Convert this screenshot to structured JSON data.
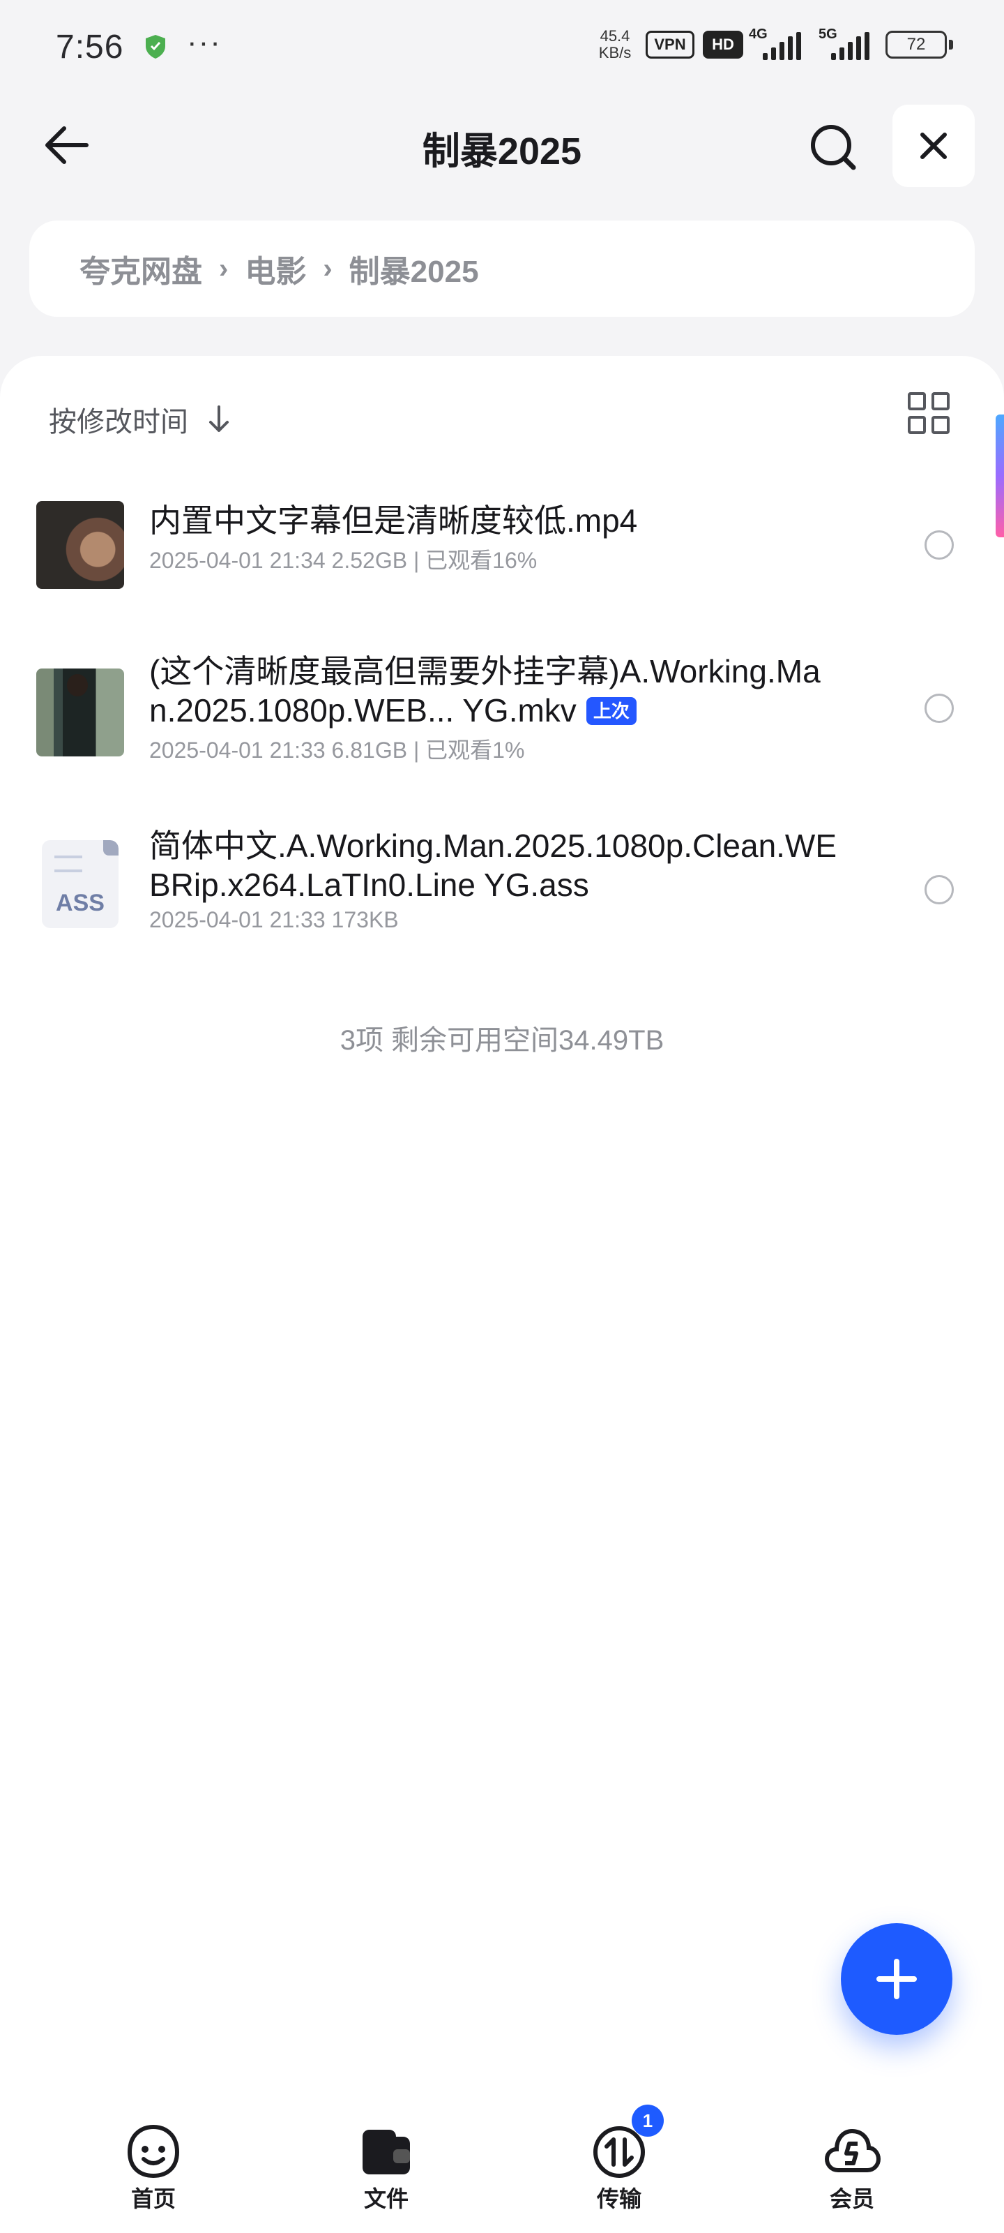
{
  "status_bar": {
    "time": "7:56",
    "more_dots": "···",
    "net_speed_value": "45.4",
    "net_speed_unit": "KB/s",
    "vpn_label": "VPN",
    "hd_label": "HD",
    "signal_1_label": "4G",
    "signal_2_label": "5G",
    "battery_level": "72"
  },
  "header": {
    "title": "制暴2025",
    "back_icon": "arrow-left-icon",
    "search_icon": "search-icon",
    "close_icon": "close-icon"
  },
  "breadcrumb": {
    "items": [
      "夸克网盘",
      "电影",
      "制暴2025"
    ],
    "separator": "›"
  },
  "toolbar": {
    "sort_label": "按修改时间",
    "sort_icon": "arrow-down-icon",
    "view_icon": "grid-view-icon"
  },
  "files": [
    {
      "name": "内置中文字幕但是清晰度较低.mp4",
      "meta": "2025-04-01 21:34   2.52GB | 已观看16%",
      "thumb": "video-thumbnail"
    },
    {
      "name": "(这个清晰度最高但需要外挂字幕)A.Working.Man.2025.1080p.WEB... YG.mkv",
      "badge": "上次",
      "meta": "2025-04-01 21:33   6.81GB | 已观看1%",
      "thumb": "video-thumbnail"
    },
    {
      "name": "简体中文.A.Working.Man.2025.1080p.Clean.WEBRip.x264.LaTIn0.Line YG.ass",
      "meta": "2025-04-01 21:33   173KB",
      "thumb": "ass-file-icon",
      "thumb_label": "ASS"
    }
  ],
  "summary": "3项 剩余可用空间34.49TB",
  "fab_icon": "plus-icon",
  "bottom_nav": {
    "items": [
      {
        "label": "首页",
        "icon": "smiley-home-icon"
      },
      {
        "label": "文件",
        "icon": "folder-icon"
      },
      {
        "label": "传输",
        "icon": "transfer-icon",
        "badge": "1"
      },
      {
        "label": "会员",
        "icon": "cloud-vip-icon"
      }
    ]
  },
  "colors": {
    "accent": "#1e5bff",
    "background": "#f4f4f6",
    "text_primary": "#18181c",
    "text_secondary": "#96989e"
  }
}
